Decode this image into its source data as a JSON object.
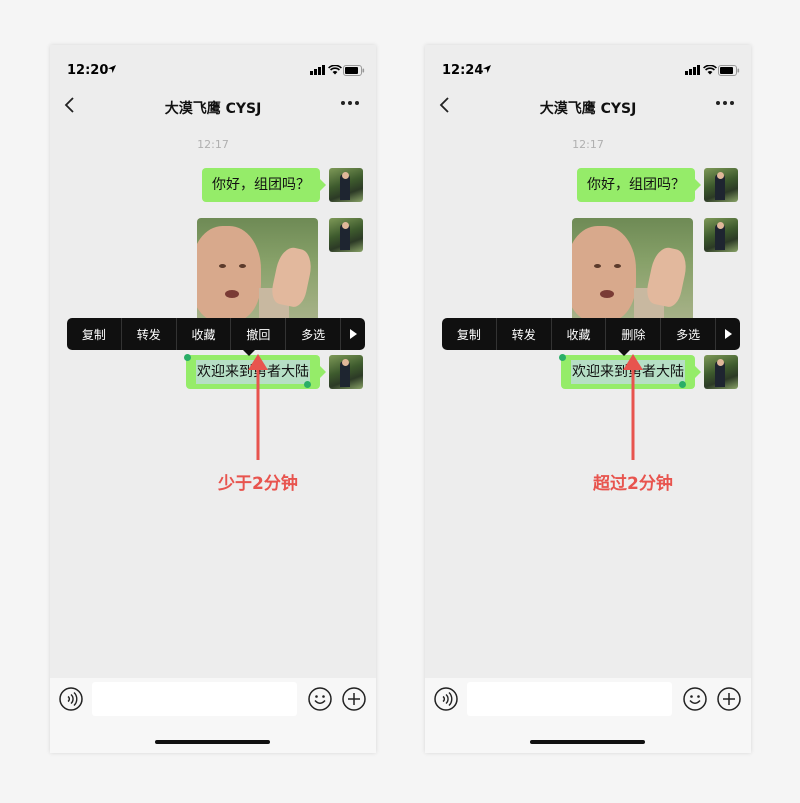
{
  "screens": [
    {
      "time": "12:20",
      "chat_title": "大漠飞鹰 CYSJ",
      "timestamp": "12:17",
      "message_1": "你好，组团吗？",
      "message_3": "欢迎来到勇者大陆",
      "menu": [
        "复制",
        "转发",
        "收藏",
        "撤回",
        "多选"
      ],
      "annotation": "少于2分钟"
    },
    {
      "time": "12:24",
      "chat_title": "大漠飞鹰 CYSJ",
      "timestamp": "12:17",
      "message_1": "你好，组团吗？",
      "message_3": "欢迎来到勇者大陆",
      "menu": [
        "复制",
        "转发",
        "收藏",
        "删除",
        "多选"
      ],
      "annotation": "超过2分钟"
    }
  ],
  "colors": {
    "bubble": "#95ec69",
    "menu_bg": "#101010",
    "annotation": "#e8544e",
    "selection_handle": "#2aae67"
  },
  "icons": {
    "status": [
      "location-arrow-icon",
      "signal-icon",
      "wifi-icon",
      "battery-icon"
    ],
    "nav": [
      "back-icon",
      "more-icon"
    ],
    "input": [
      "voice-icon",
      "emoji-icon",
      "plus-icon"
    ],
    "menu_more": "arrow-right-icon"
  }
}
